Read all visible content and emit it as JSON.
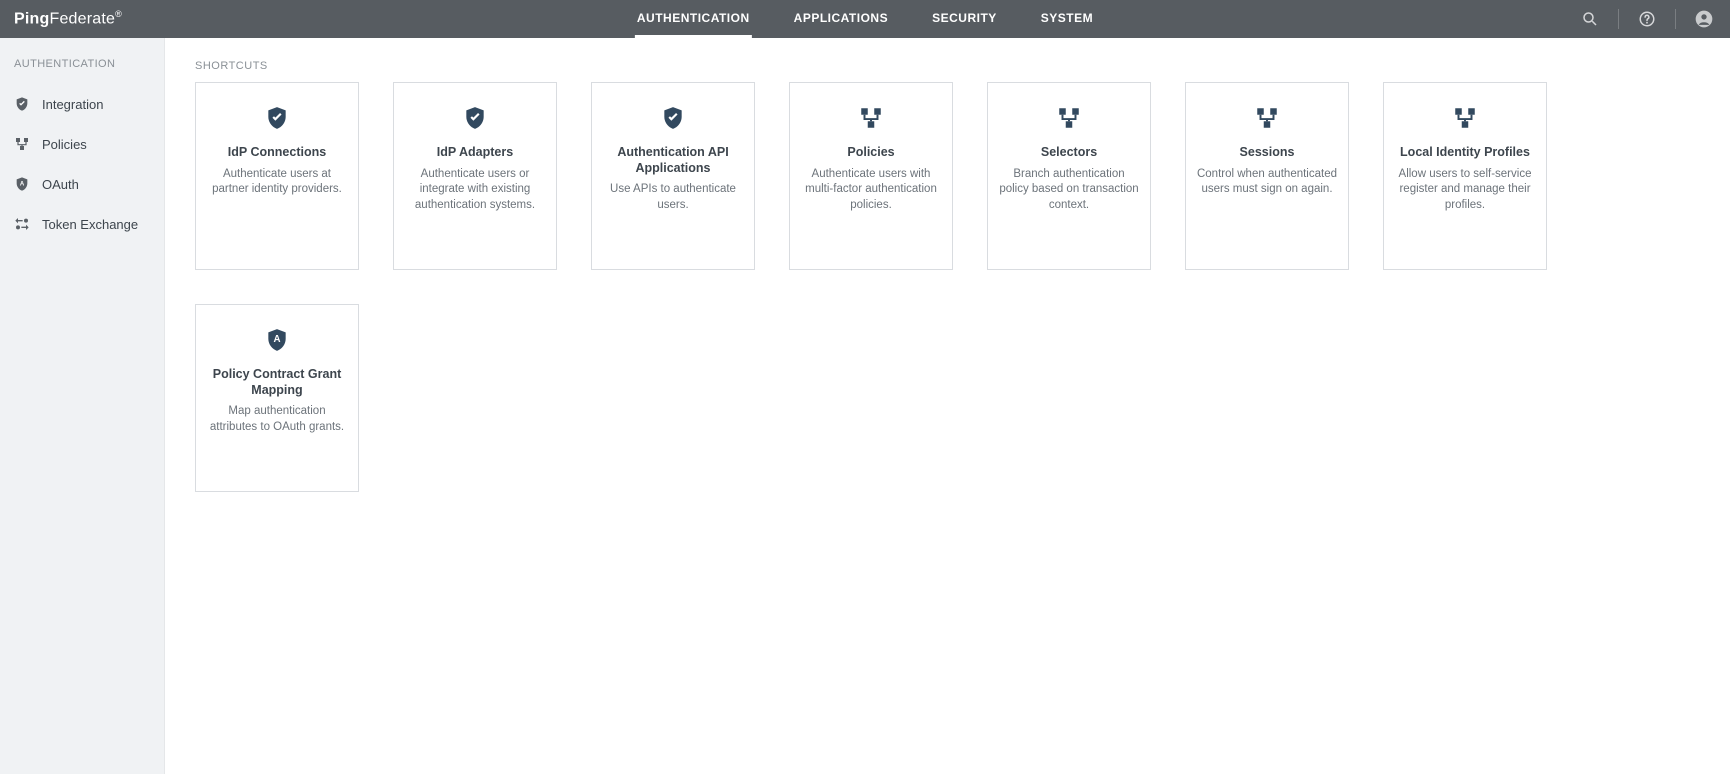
{
  "brand": {
    "strong": "Ping",
    "light": "Federate",
    "reg": "®"
  },
  "topnav": [
    {
      "label": "AUTHENTICATION",
      "active": true
    },
    {
      "label": "APPLICATIONS",
      "active": false
    },
    {
      "label": "SECURITY",
      "active": false
    },
    {
      "label": "SYSTEM",
      "active": false
    }
  ],
  "sidebar": {
    "heading": "AUTHENTICATION",
    "items": [
      {
        "label": "Integration",
        "icon": "shield-check"
      },
      {
        "label": "Policies",
        "icon": "flow"
      },
      {
        "label": "OAuth",
        "icon": "shield-a"
      },
      {
        "label": "Token Exchange",
        "icon": "exchange"
      }
    ]
  },
  "content": {
    "shortcuts_label": "SHORTCUTS",
    "cards": [
      {
        "title": "IdP Connections",
        "desc": "Authenticate users at partner identity providers.",
        "icon": "shield-check"
      },
      {
        "title": "IdP Adapters",
        "desc": "Authenticate users or integrate with existing authentication systems.",
        "icon": "shield-check"
      },
      {
        "title": "Authentication API Applications",
        "desc": "Use APIs to authenticate users.",
        "icon": "shield-check"
      },
      {
        "title": "Policies",
        "desc": "Authenticate users with multi-factor authentication policies.",
        "icon": "flow"
      },
      {
        "title": "Selectors",
        "desc": "Branch authentication policy based on transaction context.",
        "icon": "flow"
      },
      {
        "title": "Sessions",
        "desc": "Control when authenticated users must sign on again.",
        "icon": "flow"
      },
      {
        "title": "Local Identity Profiles",
        "desc": "Allow users to self-service register and manage their profiles.",
        "icon": "flow"
      },
      {
        "title": "Policy Contract Grant Mapping",
        "desc": "Map authentication attributes to OAuth grants.",
        "icon": "shield-a"
      }
    ]
  }
}
